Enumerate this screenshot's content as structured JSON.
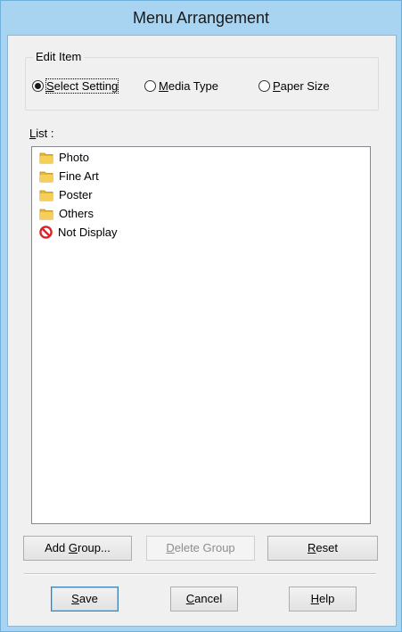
{
  "window": {
    "title": "Menu Arrangement"
  },
  "edit_item": {
    "legend": "Edit Item",
    "options": [
      {
        "prefix": "",
        "accel": "S",
        "suffix": "elect Setting",
        "checked": true
      },
      {
        "prefix": "",
        "accel": "M",
        "suffix": "edia Type",
        "checked": false
      },
      {
        "prefix": "",
        "accel": "P",
        "suffix": "aper Size",
        "checked": false
      }
    ]
  },
  "list": {
    "label_accel": "L",
    "label_rest": "ist :",
    "items": [
      {
        "label": "Photo",
        "icon": "folder-icon"
      },
      {
        "label": "Fine Art",
        "icon": "folder-icon"
      },
      {
        "label": "Poster",
        "icon": "folder-icon"
      },
      {
        "label": "Others",
        "icon": "folder-icon"
      },
      {
        "label": "Not Display",
        "icon": "no-entry-icon"
      }
    ]
  },
  "buttons": {
    "add_group": {
      "prefix": "Add ",
      "accel": "G",
      "suffix": "roup..."
    },
    "delete_group": {
      "prefix": "",
      "accel": "D",
      "suffix": "elete Group",
      "enabled": false
    },
    "reset": {
      "prefix": "",
      "accel": "R",
      "suffix": "eset"
    },
    "save": {
      "prefix": "",
      "accel": "S",
      "suffix": "ave"
    },
    "cancel": {
      "prefix": "",
      "accel": "C",
      "suffix": "ancel"
    },
    "help": {
      "prefix": "",
      "accel": "H",
      "suffix": "elp"
    }
  },
  "colors": {
    "titlebar": "#a9d4f1",
    "client": "#f0f0f0",
    "folder": "#e8b830",
    "no_entry": "#d7242b"
  }
}
